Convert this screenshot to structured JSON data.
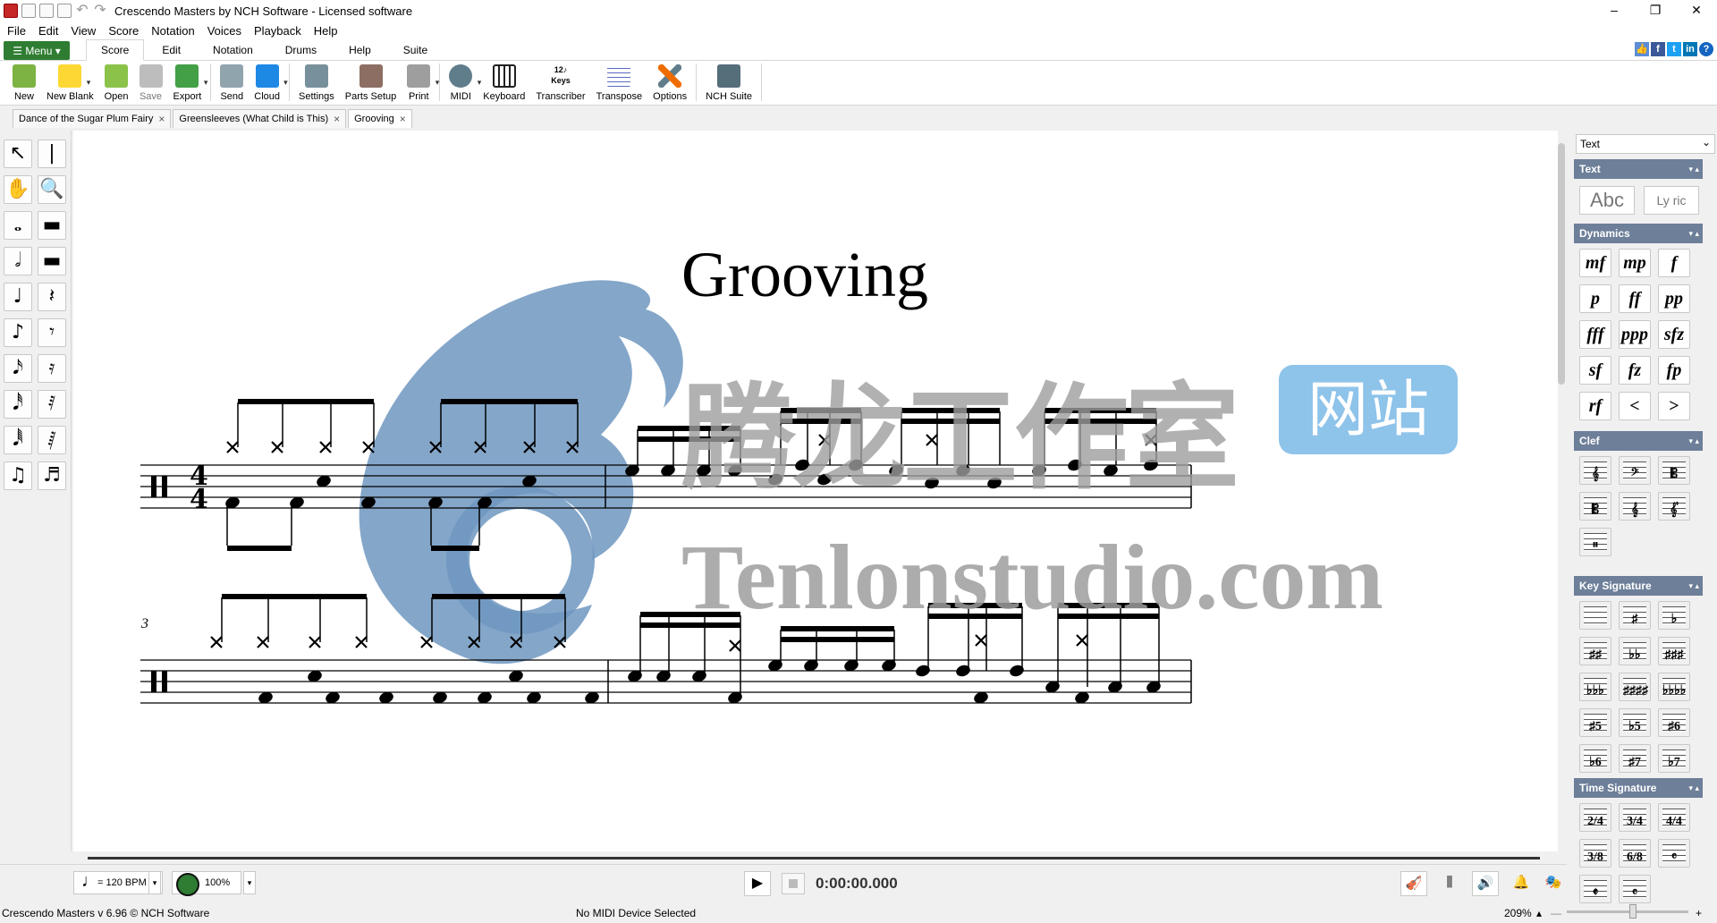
{
  "window": {
    "title": "Crescendo Masters by NCH Software - Licensed software",
    "minimize": "–",
    "maximize": "❐",
    "close": "✕"
  },
  "menubar": [
    "File",
    "Edit",
    "View",
    "Score",
    "Notation",
    "Voices",
    "Playback",
    "Help"
  ],
  "ribbon": {
    "menu_label": "☰ Menu ▾",
    "tabs": [
      "Score",
      "Edit",
      "Notation",
      "Drums",
      "Help",
      "Suite"
    ],
    "active_tab": "Score",
    "help_glyph": "?"
  },
  "toolbar": [
    {
      "label": "New",
      "icon": "new-icon",
      "color": "#7cb342"
    },
    {
      "label": "New Blank",
      "icon": "new-blank-icon",
      "color": "#fdd835"
    },
    {
      "label": "Open",
      "icon": "open-folder-icon",
      "color": "#8bc34a"
    },
    {
      "label": "Save",
      "icon": "save-icon",
      "color": "#bdbdbd"
    },
    {
      "label": "Export",
      "icon": "export-icon",
      "color": "#43a047"
    },
    {
      "label": "Send",
      "icon": "send-icon",
      "color": "#90a4ae"
    },
    {
      "label": "Cloud",
      "icon": "cloud-icon",
      "color": "#1e88e5"
    },
    {
      "label": "Settings",
      "icon": "settings-icon",
      "color": "#78909c"
    },
    {
      "label": "Parts Setup",
      "icon": "parts-setup-icon",
      "color": "#8d6e63"
    },
    {
      "label": "Print",
      "icon": "print-icon",
      "color": "#9e9e9e"
    },
    {
      "label": "MIDI",
      "icon": "midi-icon",
      "color": "#607d8b"
    },
    {
      "label": "Keyboard",
      "icon": "keyboard-icon",
      "color": "#212121"
    },
    {
      "label": "Transcriber",
      "icon": "transcriber-icon",
      "color": "#424242"
    },
    {
      "label": "Transpose",
      "icon": "transpose-icon",
      "color": "#5c6bc0"
    },
    {
      "label": "Options",
      "icon": "options-icon",
      "color": "#ef6c00"
    },
    {
      "label": "NCH Suite",
      "icon": "nch-suite-icon",
      "color": "#546e7a"
    }
  ],
  "transcriber_glyph": "12♪ Keys",
  "document_tabs": [
    {
      "label": "Dance of the Sugar Plum Fairy",
      "active": false
    },
    {
      "label": "Greensleeves (What Child is This)",
      "active": false
    },
    {
      "label": "Grooving",
      "active": true
    }
  ],
  "tab_close": "×",
  "score": {
    "title": "Grooving",
    "measure_number": "3",
    "time_signature": "4/4"
  },
  "watermark": {
    "chinese": "腾龙工作室",
    "badge": "网站",
    "english": "Tenlonstudio.com"
  },
  "left_palette": [
    "↖",
    "|",
    "✋",
    "🔍",
    "𝅝",
    "▬",
    "𝅗𝅥",
    "▬",
    "♩",
    "𝄽",
    "♪",
    "𝄾",
    "𝅘𝅥𝅯",
    "𝄿",
    "𝅘𝅥𝅰",
    "𝅀",
    "𝅘𝅥𝅱",
    "𝅁",
    "♫",
    "♬"
  ],
  "right_palette": {
    "selector": "Text",
    "sections": {
      "text": "Text",
      "dynamics": "Dynamics",
      "clef": "Clef",
      "key_signature": "Key Signature",
      "time_signature": "Time Signature"
    },
    "text_items": [
      "Abc",
      "Ly ric"
    ],
    "dynamics": [
      "mf",
      "mp",
      "f",
      "p",
      "ff",
      "pp",
      "fff",
      "ppp",
      "sfz",
      "sf",
      "fz",
      "fp",
      "rf",
      "<",
      ">"
    ],
    "clefs": [
      "𝄞",
      "𝄢",
      "𝄡",
      "𝄡",
      "𝄞",
      "𝄟",
      "𝄥"
    ],
    "key_signatures": [
      "",
      "♯",
      "♭",
      "♯♯",
      "♭♭",
      "♯♯♯",
      "♭♭♭",
      "♯♯♯♯",
      "♭♭♭♭",
      "♯5",
      "♭5",
      "♯6",
      "♭6",
      "♯7",
      "♭7"
    ],
    "time_signatures": [
      "2/4",
      "3/4",
      "4/4",
      "3/8",
      "6/8",
      "𝄴",
      "𝄵",
      "𝄴"
    ]
  },
  "transport": {
    "tempo": "= 120 BPM",
    "speed": "100%",
    "dropdown": "▾",
    "play": "▶",
    "time": "0:00:00.000",
    "icons": [
      "🎻",
      "⫼",
      "🔊",
      "🔔",
      "🎭"
    ]
  },
  "status": {
    "version": "Crescendo Masters v 6.96 © NCH Software",
    "midi": "No MIDI Device Selected",
    "zoom": "209%",
    "zoom_arrow": "▴",
    "zoom_minus": "—",
    "zoom_plus": "+"
  }
}
